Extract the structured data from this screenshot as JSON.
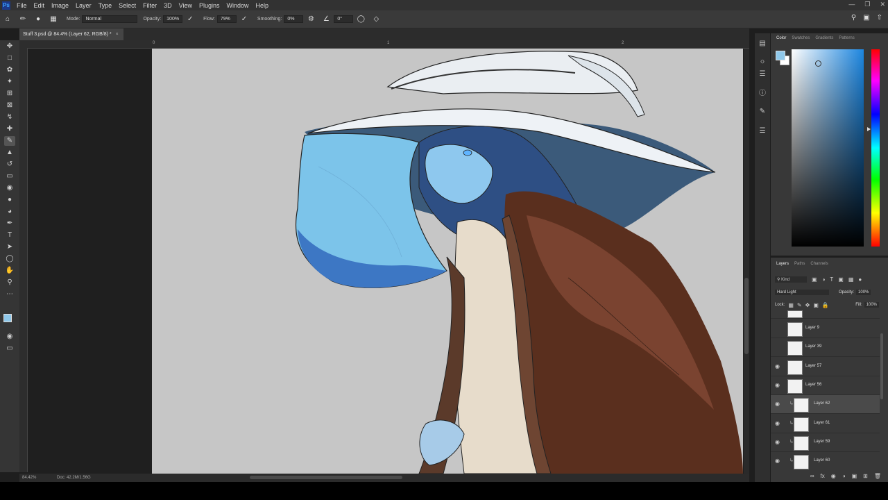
{
  "menu": [
    "File",
    "Edit",
    "Image",
    "Layer",
    "Type",
    "Select",
    "Filter",
    "3D",
    "View",
    "Plugins",
    "Window",
    "Help"
  ],
  "options_bar": {
    "mode_label": "Mode:",
    "mode_value": "Normal",
    "opacity_label": "Opacity:",
    "opacity_value": "100%",
    "flow_label": "Flow:",
    "flow_value": "79%",
    "smoothing_label": "Smoothing:",
    "smoothing_value": "0%",
    "angle_value": "0°"
  },
  "document": {
    "tab_title": "Stuff 3.psd @ 84.4% (Layer 62, RGB/8) *"
  },
  "ruler": {
    "marks": [
      "0",
      "1",
      "2"
    ]
  },
  "status": {
    "zoom": "84.42%",
    "doc": "Doc: 42.2M/1.56G"
  },
  "color_panel": {
    "tabs": [
      "Color",
      "Swatches",
      "Gradients",
      "Patterns"
    ],
    "foreground": "#8fc8ea",
    "background": "#ffffff"
  },
  "layers_panel": {
    "tabs": [
      "Layers",
      "Paths",
      "Channels"
    ],
    "filter_kind": "Kind",
    "blend_mode": "Hard Light",
    "opacity_label": "Opacity:",
    "opacity_value": "100%",
    "lock_label": "Lock:",
    "fill_label": "Fill:",
    "fill_value": "100%",
    "layers": [
      {
        "name": "Layer 9",
        "visible": false,
        "clipped": false,
        "selected": false
      },
      {
        "name": "Layer 39",
        "visible": false,
        "clipped": false,
        "selected": false
      },
      {
        "name": "Layer 57",
        "visible": true,
        "clipped": false,
        "selected": false
      },
      {
        "name": "Layer 56",
        "visible": true,
        "clipped": false,
        "selected": false
      },
      {
        "name": "Layer 62",
        "visible": true,
        "clipped": true,
        "selected": true
      },
      {
        "name": "Layer 61",
        "visible": true,
        "clipped": true,
        "selected": false
      },
      {
        "name": "Layer 59",
        "visible": true,
        "clipped": true,
        "selected": false
      },
      {
        "name": "Layer 60",
        "visible": true,
        "clipped": true,
        "selected": false
      }
    ]
  }
}
